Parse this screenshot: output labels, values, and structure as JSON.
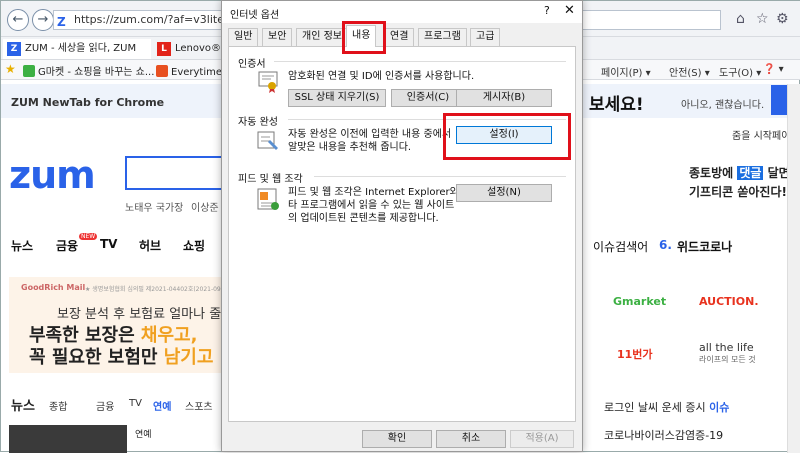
{
  "browser": {
    "url": "https://zum.com/?af=v3lite",
    "tabs": [
      {
        "label": "ZUM - 세상을 읽다, ZUM",
        "favicon": "Z"
      },
      {
        "label": "Lenovo® 한·",
        "favicon": "L"
      }
    ],
    "favorites": [
      {
        "label": "G마켓 - 쇼핑을 바꾸는 쇼..."
      },
      {
        "label": "Everytime 십"
      }
    ],
    "toolbar": {
      "page": "페이지(P) ▾",
      "safety": "안전(S) ▾",
      "tools": "도구(O) ▾",
      "help": "❓ ▾"
    }
  },
  "page": {
    "newtab_text": "ZUM NewTab for Chrome",
    "banner_bold": "보세요!",
    "banner_small": "아니오, 괜찮습니다.",
    "start_page": "줌을 시작페이",
    "logo": "zum",
    "keywords": [
      "노태우 국가장",
      "이상준 섭"
    ],
    "ad_right_line1_pre": "종토방에 ",
    "ad_right_line1_badge": "댓글",
    "ad_right_line1_post": " 달면",
    "ad_right_line2": "기프티콘 쏟아진다!",
    "menu": [
      "뉴스",
      "금융",
      "TV",
      "허브",
      "쇼핑"
    ],
    "menu_badge": "NEW",
    "issue_label": "이슈검색어",
    "issue_rank": "6.",
    "issue_item": "위드코로나",
    "ad_brand": "GoodRich Mail",
    "ad_tiny": "★ 생명보험협회 심의필 제2021-04402호(2021-09-29~2022",
    "ad_line1": "보장 분석 후 보험료 얼마나 줄어들",
    "ad_line2_pre": "부족한 보장은 ",
    "ad_line2_hl": "채우고,",
    "ad_line3_pre": "꼭 필요한 보험만 ",
    "ad_line3_hl": "남기고",
    "shops": [
      "Gmarket",
      "AUCTION.",
      "11번가",
      "all the life",
      "라이프의 모든 것"
    ],
    "news_title": "뉴스",
    "news_cats": [
      "종합",
      "금융",
      "TV",
      "연예",
      "스포츠"
    ],
    "bottom_links": [
      "로그인",
      "날씨",
      "운세",
      "증시",
      "이슈"
    ],
    "bottom_issue": "코로나바이러스감염증-19",
    "news_snip": "연예"
  },
  "dialog": {
    "title": "인터넷 옵션",
    "help": "?",
    "close": "✕",
    "tabs": [
      "일반",
      "보안",
      "개인 정보",
      "내용",
      "연결",
      "프로그램",
      "고급"
    ],
    "sections": {
      "cert": {
        "title": "인증서",
        "text": "암호화된 연결 및 ID에 인증서를 사용합니다.",
        "buttons": [
          "SSL 상태 지우기(S)",
          "인증서(C)",
          "게시자(B)"
        ]
      },
      "autocomplete": {
        "title": "자동 완성",
        "text1": "자동 완성은 이전에 입력한 내용 중에서",
        "text2": "알맞은 내용을 추천해 줍니다.",
        "button": "설정(I)"
      },
      "feeds": {
        "title": "피드 및 웹 조각",
        "text1": "피드 및 웹 조각은 Internet Explorer와 기",
        "text2": "타 프로그램에서 읽을 수 있는 웹 사이트",
        "text3": "의 업데이트된 콘텐츠를 제공합니다.",
        "button": "설정(N)"
      }
    },
    "footer": [
      "확인",
      "취소",
      "적용(A)"
    ],
    "highlight_color": "#e0101a"
  }
}
